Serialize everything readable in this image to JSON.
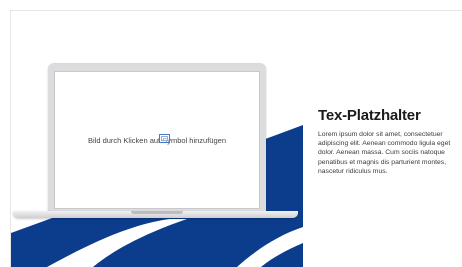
{
  "placeholder": {
    "image_prompt": "Bild durch Klicken auf Symbol hinzufügen",
    "insert_icon": "insert-picture-icon"
  },
  "text_panel": {
    "title": "Tex-Platzhalter",
    "body": "Lorem ipsum dolor sit amet, consectetuer adipiscing elit. Aenean commodo ligula eget dolor. Aenean massa. Cum sociis natoque penatibus et magnis dis parturient montes, nascetur ridiculus mus."
  },
  "colors": {
    "brand_blue": "#0b3d8c",
    "background": "#ffffff",
    "title_text": "#1b1b1b",
    "body_text": "#3a3a3a"
  }
}
